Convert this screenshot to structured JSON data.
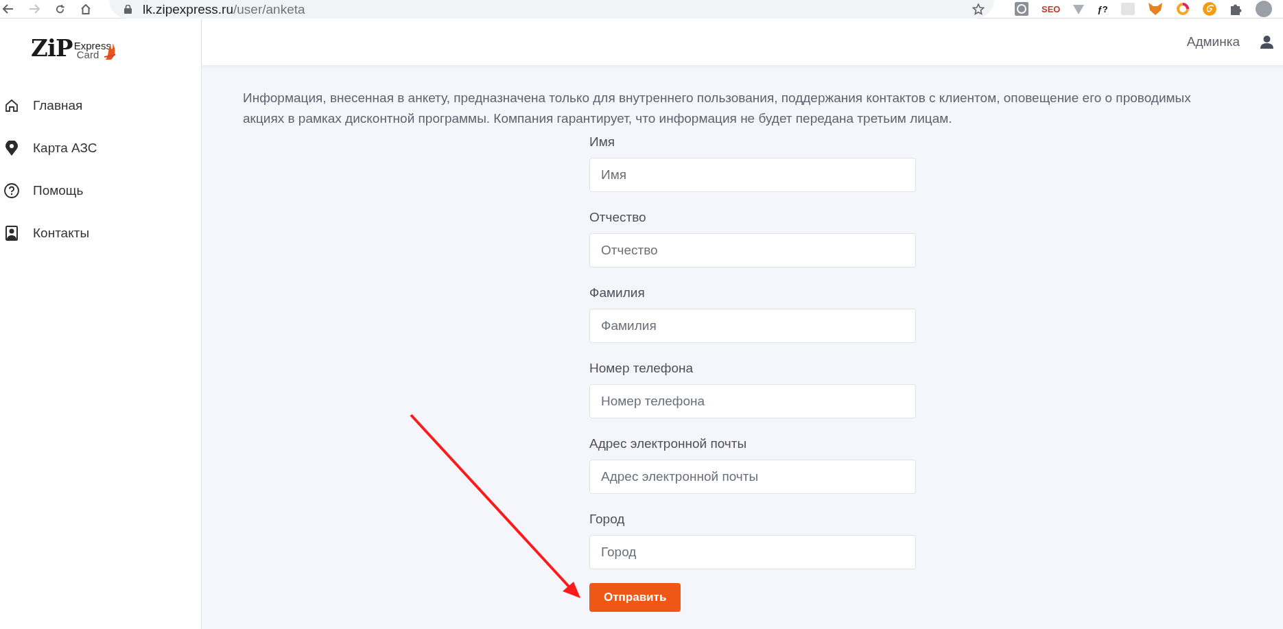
{
  "browser": {
    "url_host": "lk.zipexpress.ru",
    "url_path": "/user/anketa",
    "extensions": [
      {
        "kind": "clock"
      },
      {
        "kind": "label",
        "label": "SEO",
        "color": "#c0392b"
      },
      {
        "kind": "triangle"
      },
      {
        "kind": "label",
        "label": "ƒ?",
        "color": "#111111"
      },
      {
        "kind": "square"
      },
      {
        "kind": "fox"
      },
      {
        "kind": "ring"
      },
      {
        "kind": "spiral"
      },
      {
        "kind": "puzzle"
      },
      {
        "kind": "avatar"
      }
    ]
  },
  "logo": {
    "main": "ZiP",
    "top": "Express",
    "bottom": "Card"
  },
  "sidebar": {
    "items": [
      {
        "label": "Главная",
        "kind": "home"
      },
      {
        "label": "Карта АЗС",
        "kind": "pin"
      },
      {
        "label": "Помощь",
        "kind": "help"
      },
      {
        "label": "Контакты",
        "kind": "contact"
      }
    ]
  },
  "header": {
    "user": "Админка"
  },
  "notice": "Информация, внесенная в анкету, предназначена только для внутреннего пользования, поддержания контактов с клиентом, оповещение его о проводимых акциях в рамках дисконтной программы. Компания гарантирует, что информация не будет передана третьим лицам.",
  "form": {
    "fields": [
      {
        "label": "Имя",
        "placeholder": "Имя"
      },
      {
        "label": "Отчество",
        "placeholder": "Отчество"
      },
      {
        "label": "Фамилия",
        "placeholder": "Фамилия"
      },
      {
        "label": "Номер телефона",
        "placeholder": "Номер телефона"
      },
      {
        "label": "Адрес электронной почты",
        "placeholder": "Адрес электронной почты"
      },
      {
        "label": "Город",
        "placeholder": "Город"
      }
    ],
    "submit": "Отправить"
  }
}
